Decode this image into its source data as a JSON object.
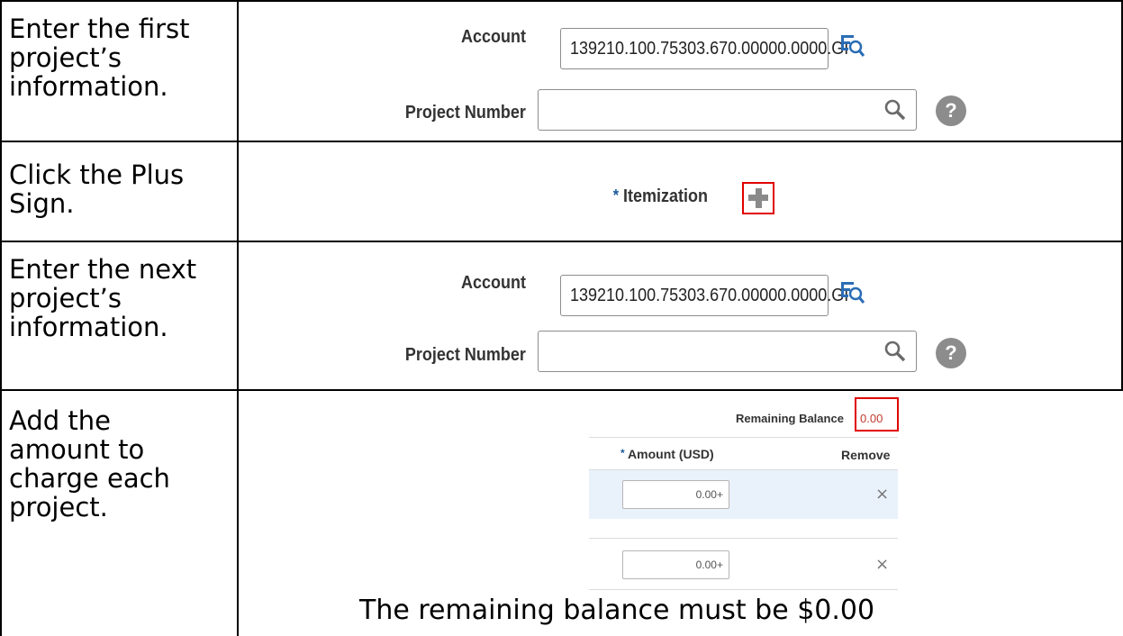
{
  "steps": [
    {
      "text": [
        "Enter the first",
        "project’s",
        "information."
      ]
    },
    {
      "text": [
        "Click the Plus",
        "Sign."
      ]
    },
    {
      "text": [
        "Enter the next",
        "project’s",
        "information."
      ]
    },
    {
      "text": [
        "Add the",
        "amount to",
        "charge each",
        "project."
      ]
    }
  ],
  "form1": {
    "account_label": "Account",
    "account_value": "139210.100.75303.670.00000.0000.GI",
    "project_number_label": "Project Number"
  },
  "itemization": {
    "required_mark": "*",
    "label": "Itemization"
  },
  "form2": {
    "account_label": "Account",
    "account_value": "139210.100.75303.670.00000.0000.GI",
    "project_number_label": "Project Number"
  },
  "amounts": {
    "remaining_balance_label": "Remaining Balance",
    "remaining_balance_value": "0.00",
    "required_mark": "*",
    "amount_header": "Amount (USD)",
    "remove_header": "Remove",
    "rows": [
      {
        "value": "0.00+",
        "remove": "×"
      },
      {
        "value": "0.00+",
        "remove": "×"
      }
    ]
  },
  "note": "The remaining balance must be $0.00",
  "colors": {
    "highlight_border": "#e00000",
    "required_star": "#1d5b9a",
    "balance_value": "#c0392b",
    "row_highlight": "#e9f1fb"
  },
  "icons": {
    "lookup": "lookup-icon",
    "search": "search-icon",
    "help": "help-icon",
    "plus": "plus-icon",
    "remove": "close-icon"
  }
}
